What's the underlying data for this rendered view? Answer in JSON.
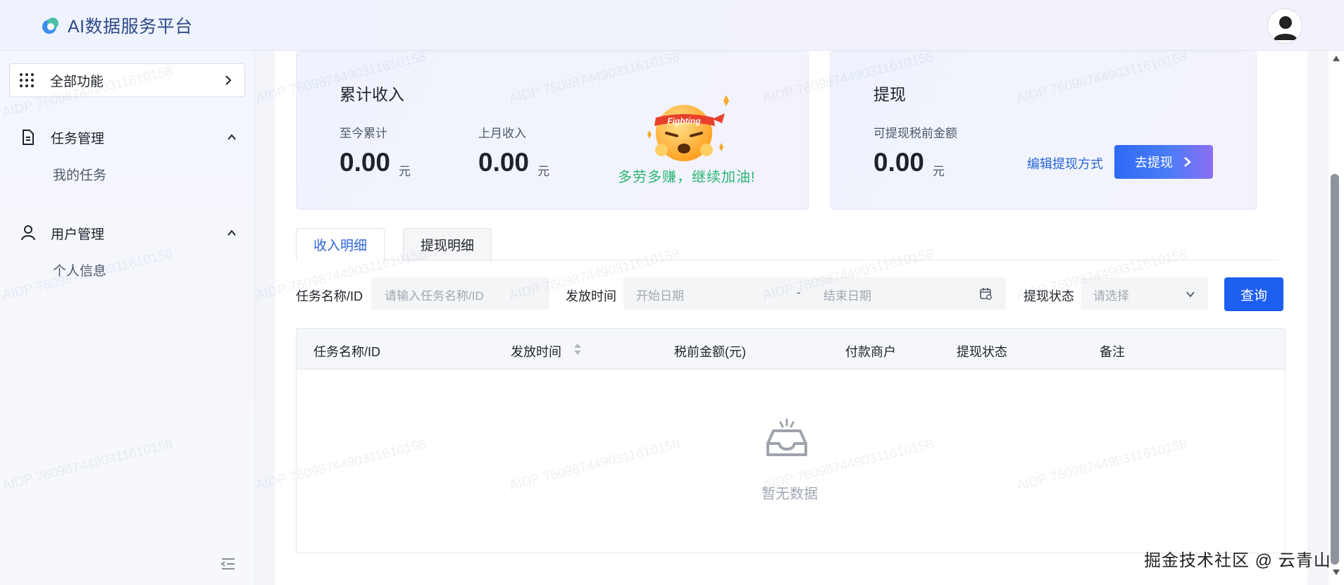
{
  "header": {
    "app_title": "AI数据服务平台",
    "logo_icon": "cloud-logo-icon",
    "avatar_icon": "user-avatar-icon"
  },
  "sidebar": {
    "all_functions": "全部功能",
    "groups": [
      {
        "label": "任务管理",
        "icon": "document-icon",
        "expanded": true,
        "items": [
          "我的任务"
        ]
      },
      {
        "label": "用户管理",
        "icon": "user-icon",
        "expanded": true,
        "items": [
          "个人信息"
        ]
      }
    ],
    "collapse_icon": "collapse-sidebar-icon"
  },
  "income_card": {
    "title": "累计收入",
    "total_label": "至今累计",
    "total_value": "0.00",
    "last_month_label": "上月收入",
    "last_month_value": "0.00",
    "unit": "元",
    "badge_text": "Fighting",
    "cheer": "多劳多赚，继续加油!"
  },
  "withdraw_card": {
    "title": "提现",
    "available_label": "可提现税前金额",
    "available_value": "0.00",
    "unit": "元",
    "edit_link": "编辑提现方式",
    "withdraw_button": "去提现"
  },
  "tabs": [
    {
      "label": "收入明细",
      "active": true
    },
    {
      "label": "提现明细",
      "active": false
    }
  ],
  "filters": {
    "task_label": "任务名称/ID",
    "task_placeholder": "请输入任务名称/ID",
    "time_label": "发放时间",
    "start_placeholder": "开始日期",
    "range_separator": "-",
    "end_placeholder": "结束日期",
    "status_label": "提现状态",
    "status_placeholder": "请选择",
    "query_button": "查询"
  },
  "table": {
    "columns": [
      "任务名称/ID",
      "发放时间",
      "税前金额(元)",
      "付款商户",
      "提现状态",
      "备注"
    ],
    "rows": [],
    "empty_text": "暂无数据"
  },
  "watermark": {
    "text": "AIDP 7609874490311610158"
  },
  "footer_watermark": "掘金技术社区 @ 云青山",
  "colors": {
    "primary": "#1d5ef0",
    "link": "#2a64d8",
    "cheer": "#2bb673"
  }
}
